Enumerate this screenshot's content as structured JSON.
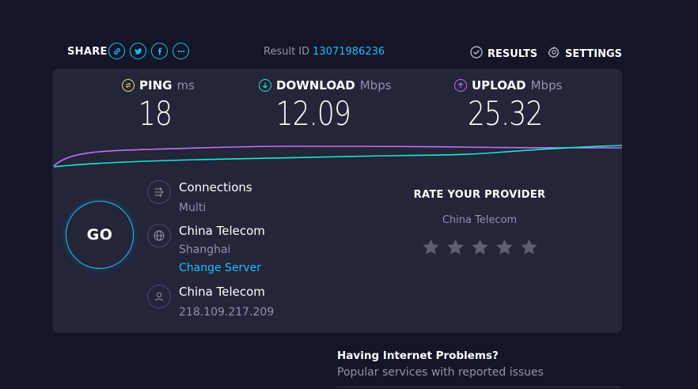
{
  "header": {
    "share_label": "SHARE",
    "share_icons": [
      "link-icon",
      "twitter-icon",
      "facebook-icon",
      "more-icon"
    ],
    "result_id_label": "Result ID",
    "result_id_value": "13071986236",
    "results_label": "RESULTS",
    "settings_label": "SETTINGS"
  },
  "metrics": {
    "ping": {
      "label": "PING",
      "unit": "ms",
      "value": "18",
      "color": "#f6d97a"
    },
    "download": {
      "label": "DOWNLOAD",
      "unit": "Mbps",
      "value": "12.09",
      "color": "#1ee3cf"
    },
    "upload": {
      "label": "UPLOAD",
      "unit": "Mbps",
      "value": "25.32",
      "color": "#bf71f2"
    }
  },
  "go_label": "GO",
  "connections": {
    "label": "Connections",
    "value": "Multi"
  },
  "server": {
    "name": "China Telecom",
    "location": "Shanghai",
    "change_label": "Change Server"
  },
  "isp": {
    "name": "China Telecom",
    "ip": "218.109.217.209"
  },
  "rate": {
    "title": "RATE YOUR PROVIDER",
    "provider": "China Telecom",
    "stars_total": 5,
    "stars_selected": 0
  },
  "problems": {
    "title": "Having Internet Problems?",
    "subtitle": "Popular services with reported issues"
  },
  "colors": {
    "accent": "#1cbfff",
    "background": "#141526",
    "panel": "#232539",
    "muted": "#9193a8"
  }
}
